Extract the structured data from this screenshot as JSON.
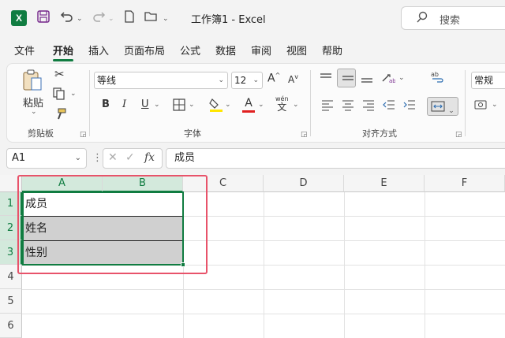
{
  "titlebar": {
    "title": "工作簿1  -  Excel",
    "logo_letter": "X",
    "search_placeholder": "搜索",
    "icons": [
      "save-icon",
      "undo-icon",
      "redo-icon",
      "new-file-icon",
      "open-folder-icon"
    ]
  },
  "menu": {
    "tabs": [
      "文件",
      "开始",
      "插入",
      "页面布局",
      "公式",
      "数据",
      "审阅",
      "视图",
      "帮助"
    ],
    "active": "开始"
  },
  "ribbon": {
    "clipboard": {
      "label": "剪贴板",
      "paste": "粘贴"
    },
    "font": {
      "label": "字体",
      "font_name": "等线",
      "font_size": "12",
      "bold": "B",
      "italic": "I",
      "underline": "U",
      "phonetic_top": "wén",
      "phonetic_bottom": "文",
      "grow": "A",
      "shrink": "A",
      "color_letter": "A"
    },
    "alignment": {
      "label": "对齐方式"
    },
    "number": {
      "format": "常规"
    }
  },
  "formula_bar": {
    "name_box": "A1",
    "fx": "fx",
    "content": "成员"
  },
  "grid": {
    "columns": [
      "A",
      "B",
      "C",
      "D",
      "E",
      "F"
    ],
    "rows": [
      "1",
      "2",
      "3",
      "4",
      "5",
      "6"
    ],
    "cells": {
      "r1": "成员",
      "r2": "姓名",
      "r3": "性别"
    }
  },
  "colors": {
    "accent": "#107c41",
    "highlight_box": "#e8536a",
    "cell_fill": "#d0d0d0"
  }
}
